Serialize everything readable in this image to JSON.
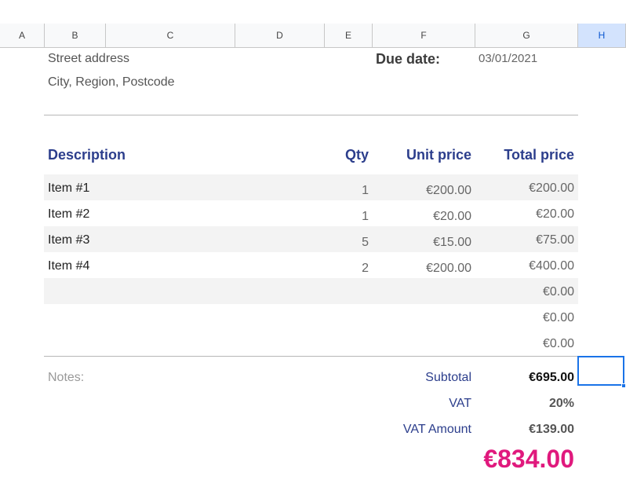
{
  "columns": [
    "A",
    "B",
    "C",
    "D",
    "E",
    "F",
    "G",
    "H"
  ],
  "address": {
    "street": "Street address",
    "city": "City, Region, Postcode"
  },
  "due": {
    "label": "Due date:",
    "value": "03/01/2021"
  },
  "table_headers": {
    "description": "Description",
    "qty": "Qty",
    "unit_price": "Unit price",
    "total_price": "Total price"
  },
  "items": [
    {
      "description": "Item #1",
      "qty": "1",
      "unit_price": "€200.00",
      "total": "€200.00"
    },
    {
      "description": "Item #2",
      "qty": "1",
      "unit_price": "€20.00",
      "total": "€20.00"
    },
    {
      "description": "Item #3",
      "qty": "5",
      "unit_price": "€15.00",
      "total": "€75.00"
    },
    {
      "description": "Item #4",
      "qty": "2",
      "unit_price": "€200.00",
      "total": "€400.00"
    },
    {
      "description": "",
      "qty": "",
      "unit_price": "",
      "total": "€0.00"
    },
    {
      "description": "",
      "qty": "",
      "unit_price": "",
      "total": "€0.00"
    },
    {
      "description": "",
      "qty": "",
      "unit_price": "",
      "total": "€0.00"
    }
  ],
  "notes_label": "Notes:",
  "summary": {
    "subtotal_label": "Subtotal",
    "subtotal_value": "€695.00",
    "vat_label": "VAT",
    "vat_value": "20%",
    "vat_amount_label": "VAT Amount",
    "vat_amount_value": "€139.00",
    "grand_total": "€834.00"
  },
  "colors": {
    "header_blue": "#2c3e8c",
    "total_pink": "#e0197d",
    "selection_blue": "#1a73e8"
  }
}
